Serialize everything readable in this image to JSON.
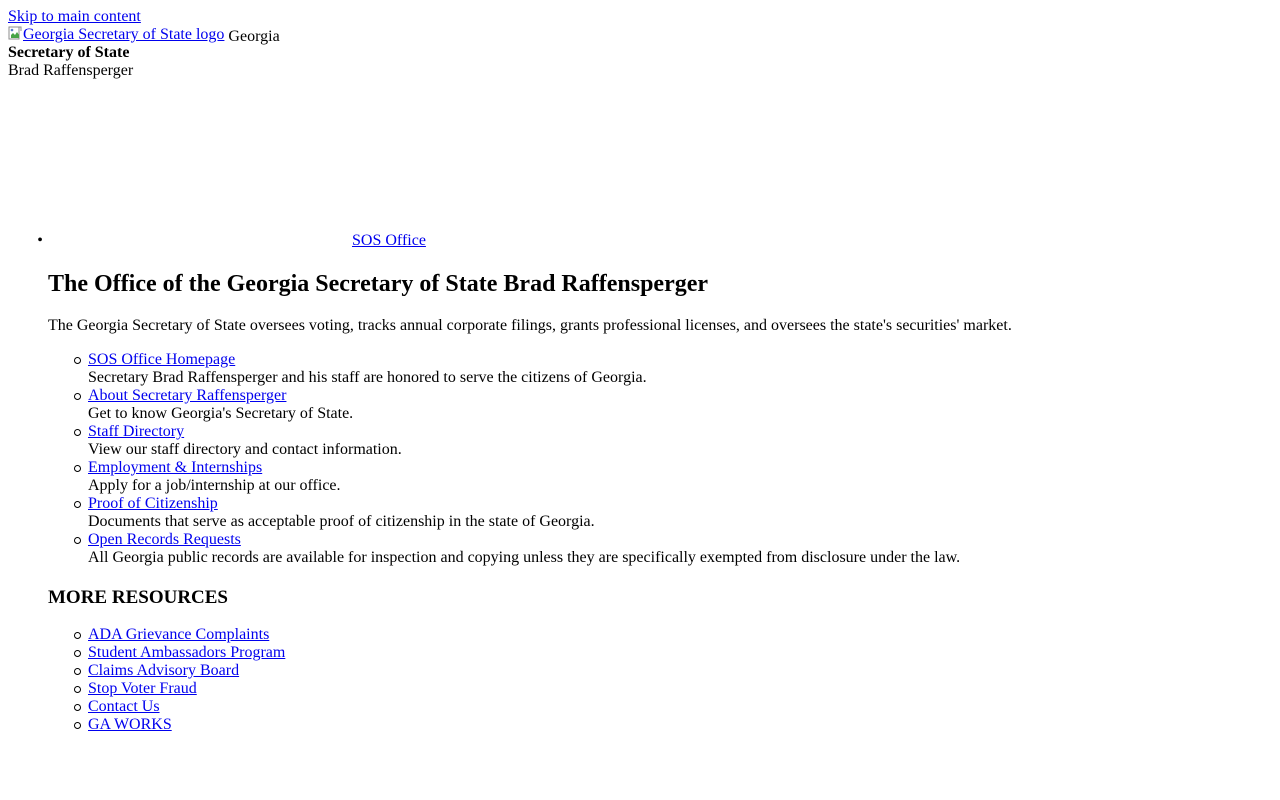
{
  "skip_link": "Skip to main content",
  "header": {
    "logo_alt": "Georgia Secretary of State logo",
    "state": "Georgia",
    "title": "Secretary of State",
    "official": "Brad Raffensperger"
  },
  "nav": {
    "items": [
      {
        "label": "SOS Office"
      }
    ]
  },
  "main": {
    "heading": "The Office of the Georgia Secretary of State Brad Raffensperger",
    "intro": "The Georgia Secretary of State oversees voting, tracks annual corporate filings, grants professional licenses, and oversees the state's securities' market.",
    "links": [
      {
        "label": "SOS Office Homepage",
        "description": "Secretary Brad Raffensperger and his staff are honored to serve the citizens of Georgia."
      },
      {
        "label": "About Secretary Raffensperger",
        "description": "Get to know Georgia's Secretary of State."
      },
      {
        "label": "Staff Directory",
        "description": "View our staff directory and contact information."
      },
      {
        "label": "Employment & Internships",
        "description": "Apply for a job/internship at our office."
      },
      {
        "label": "Proof of Citizenship",
        "description": "Documents that serve as acceptable proof of citizenship in the state of Georgia."
      },
      {
        "label": "Open Records Requests",
        "description": "All Georgia public records are available for inspection and copying unless they are specifically exempted from disclosure under the law."
      }
    ]
  },
  "resources": {
    "heading": "MORE RESOURCES",
    "links": [
      {
        "label": "ADA Grievance Complaints"
      },
      {
        "label": "Student Ambassadors Program"
      },
      {
        "label": "Claims Advisory Board"
      },
      {
        "label": "Stop Voter Fraud"
      },
      {
        "label": "Contact Us"
      },
      {
        "label": "GA WORKS"
      }
    ]
  },
  "colors": {
    "link": "#0000ee",
    "text": "#000000",
    "background": "#ffffff"
  },
  "icons": {
    "logo_placeholder": "broken-image-icon",
    "nav_bullet": "disc-bullet-icon",
    "list_bullet": "circle-bullet-icon"
  }
}
